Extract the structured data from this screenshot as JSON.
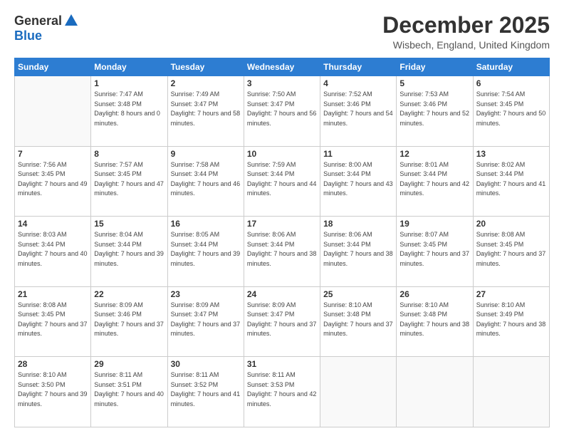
{
  "logo": {
    "general": "General",
    "blue": "Blue"
  },
  "title": "December 2025",
  "location": "Wisbech, England, United Kingdom",
  "days_header": [
    "Sunday",
    "Monday",
    "Tuesday",
    "Wednesday",
    "Thursday",
    "Friday",
    "Saturday"
  ],
  "weeks": [
    [
      {
        "day": "",
        "sunrise": "",
        "sunset": "",
        "daylight": ""
      },
      {
        "day": "1",
        "sunrise": "Sunrise: 7:47 AM",
        "sunset": "Sunset: 3:48 PM",
        "daylight": "Daylight: 8 hours and 0 minutes."
      },
      {
        "day": "2",
        "sunrise": "Sunrise: 7:49 AM",
        "sunset": "Sunset: 3:47 PM",
        "daylight": "Daylight: 7 hours and 58 minutes."
      },
      {
        "day": "3",
        "sunrise": "Sunrise: 7:50 AM",
        "sunset": "Sunset: 3:47 PM",
        "daylight": "Daylight: 7 hours and 56 minutes."
      },
      {
        "day": "4",
        "sunrise": "Sunrise: 7:52 AM",
        "sunset": "Sunset: 3:46 PM",
        "daylight": "Daylight: 7 hours and 54 minutes."
      },
      {
        "day": "5",
        "sunrise": "Sunrise: 7:53 AM",
        "sunset": "Sunset: 3:46 PM",
        "daylight": "Daylight: 7 hours and 52 minutes."
      },
      {
        "day": "6",
        "sunrise": "Sunrise: 7:54 AM",
        "sunset": "Sunset: 3:45 PM",
        "daylight": "Daylight: 7 hours and 50 minutes."
      }
    ],
    [
      {
        "day": "7",
        "sunrise": "Sunrise: 7:56 AM",
        "sunset": "Sunset: 3:45 PM",
        "daylight": "Daylight: 7 hours and 49 minutes."
      },
      {
        "day": "8",
        "sunrise": "Sunrise: 7:57 AM",
        "sunset": "Sunset: 3:45 PM",
        "daylight": "Daylight: 7 hours and 47 minutes."
      },
      {
        "day": "9",
        "sunrise": "Sunrise: 7:58 AM",
        "sunset": "Sunset: 3:44 PM",
        "daylight": "Daylight: 7 hours and 46 minutes."
      },
      {
        "day": "10",
        "sunrise": "Sunrise: 7:59 AM",
        "sunset": "Sunset: 3:44 PM",
        "daylight": "Daylight: 7 hours and 44 minutes."
      },
      {
        "day": "11",
        "sunrise": "Sunrise: 8:00 AM",
        "sunset": "Sunset: 3:44 PM",
        "daylight": "Daylight: 7 hours and 43 minutes."
      },
      {
        "day": "12",
        "sunrise": "Sunrise: 8:01 AM",
        "sunset": "Sunset: 3:44 PM",
        "daylight": "Daylight: 7 hours and 42 minutes."
      },
      {
        "day": "13",
        "sunrise": "Sunrise: 8:02 AM",
        "sunset": "Sunset: 3:44 PM",
        "daylight": "Daylight: 7 hours and 41 minutes."
      }
    ],
    [
      {
        "day": "14",
        "sunrise": "Sunrise: 8:03 AM",
        "sunset": "Sunset: 3:44 PM",
        "daylight": "Daylight: 7 hours and 40 minutes."
      },
      {
        "day": "15",
        "sunrise": "Sunrise: 8:04 AM",
        "sunset": "Sunset: 3:44 PM",
        "daylight": "Daylight: 7 hours and 39 minutes."
      },
      {
        "day": "16",
        "sunrise": "Sunrise: 8:05 AM",
        "sunset": "Sunset: 3:44 PM",
        "daylight": "Daylight: 7 hours and 39 minutes."
      },
      {
        "day": "17",
        "sunrise": "Sunrise: 8:06 AM",
        "sunset": "Sunset: 3:44 PM",
        "daylight": "Daylight: 7 hours and 38 minutes."
      },
      {
        "day": "18",
        "sunrise": "Sunrise: 8:06 AM",
        "sunset": "Sunset: 3:44 PM",
        "daylight": "Daylight: 7 hours and 38 minutes."
      },
      {
        "day": "19",
        "sunrise": "Sunrise: 8:07 AM",
        "sunset": "Sunset: 3:45 PM",
        "daylight": "Daylight: 7 hours and 37 minutes."
      },
      {
        "day": "20",
        "sunrise": "Sunrise: 8:08 AM",
        "sunset": "Sunset: 3:45 PM",
        "daylight": "Daylight: 7 hours and 37 minutes."
      }
    ],
    [
      {
        "day": "21",
        "sunrise": "Sunrise: 8:08 AM",
        "sunset": "Sunset: 3:45 PM",
        "daylight": "Daylight: 7 hours and 37 minutes."
      },
      {
        "day": "22",
        "sunrise": "Sunrise: 8:09 AM",
        "sunset": "Sunset: 3:46 PM",
        "daylight": "Daylight: 7 hours and 37 minutes."
      },
      {
        "day": "23",
        "sunrise": "Sunrise: 8:09 AM",
        "sunset": "Sunset: 3:47 PM",
        "daylight": "Daylight: 7 hours and 37 minutes."
      },
      {
        "day": "24",
        "sunrise": "Sunrise: 8:09 AM",
        "sunset": "Sunset: 3:47 PM",
        "daylight": "Daylight: 7 hours and 37 minutes."
      },
      {
        "day": "25",
        "sunrise": "Sunrise: 8:10 AM",
        "sunset": "Sunset: 3:48 PM",
        "daylight": "Daylight: 7 hours and 37 minutes."
      },
      {
        "day": "26",
        "sunrise": "Sunrise: 8:10 AM",
        "sunset": "Sunset: 3:48 PM",
        "daylight": "Daylight: 7 hours and 38 minutes."
      },
      {
        "day": "27",
        "sunrise": "Sunrise: 8:10 AM",
        "sunset": "Sunset: 3:49 PM",
        "daylight": "Daylight: 7 hours and 38 minutes."
      }
    ],
    [
      {
        "day": "28",
        "sunrise": "Sunrise: 8:10 AM",
        "sunset": "Sunset: 3:50 PM",
        "daylight": "Daylight: 7 hours and 39 minutes."
      },
      {
        "day": "29",
        "sunrise": "Sunrise: 8:11 AM",
        "sunset": "Sunset: 3:51 PM",
        "daylight": "Daylight: 7 hours and 40 minutes."
      },
      {
        "day": "30",
        "sunrise": "Sunrise: 8:11 AM",
        "sunset": "Sunset: 3:52 PM",
        "daylight": "Daylight: 7 hours and 41 minutes."
      },
      {
        "day": "31",
        "sunrise": "Sunrise: 8:11 AM",
        "sunset": "Sunset: 3:53 PM",
        "daylight": "Daylight: 7 hours and 42 minutes."
      },
      {
        "day": "",
        "sunrise": "",
        "sunset": "",
        "daylight": ""
      },
      {
        "day": "",
        "sunrise": "",
        "sunset": "",
        "daylight": ""
      },
      {
        "day": "",
        "sunrise": "",
        "sunset": "",
        "daylight": ""
      }
    ]
  ]
}
